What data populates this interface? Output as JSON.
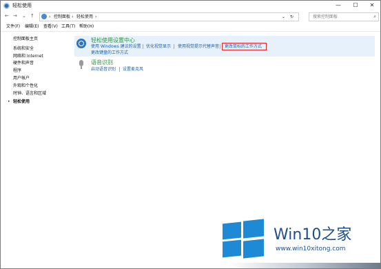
{
  "window": {
    "title": "轻松使用"
  },
  "controls": {
    "minimize": "—",
    "maximize": "☐",
    "close": "✕"
  },
  "address": {
    "back": "←",
    "forward": "→",
    "history": "⌄",
    "up": "↑",
    "crumbs": [
      "控制面板",
      "轻松使用"
    ],
    "separator": "›",
    "dropdown": "⌄",
    "refresh": "↻"
  },
  "search": {
    "placeholder": "搜索控制面板"
  },
  "menu": [
    "文件(F)",
    "编辑(E)",
    "查看(V)",
    "工具(T)",
    "帮助(H)"
  ],
  "sidebar": {
    "home": "控制面板主页",
    "items": [
      "系统和安全",
      "网络和 Internet",
      "硬件和声音",
      "程序",
      "用户帐户",
      "外观和个性化",
      "时钟、语言和区域"
    ],
    "active": "轻松使用",
    "bullet": "•"
  },
  "categories": [
    {
      "title": "轻松使用设置中心",
      "icon": "ease-of-access-icon",
      "links": [
        "使用 Windows 建议的设置",
        "优化视觉显示",
        "使用视觉提示代替声音",
        "更改鼠标的工作方式",
        "更改键盘的工作方式"
      ],
      "highlighted": "更改鼠标的工作方式"
    },
    {
      "title": "语音识别",
      "icon": "microphone-icon",
      "links": [
        "启动语音识别",
        "设置麦克风"
      ]
    }
  ],
  "watermark": {
    "brand": "Win10之家",
    "url": "www.win10xitong.com",
    "logo": "windows-logo-icon"
  },
  "colors": {
    "category_title": "#2a9a3a",
    "link": "#1a5fb4",
    "highlight_panel": "#e6f1fb",
    "highlight_border": "#e02020",
    "logo_blue": "#1e8ad6"
  }
}
